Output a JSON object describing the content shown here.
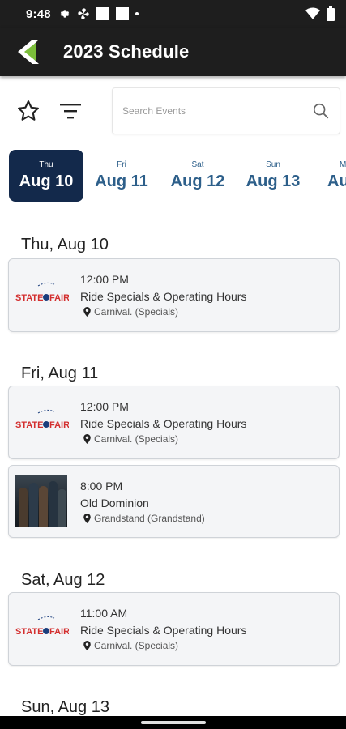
{
  "status_bar": {
    "time": "9:48",
    "icons": [
      "gear-icon",
      "fan-icon",
      "notification-square-icon",
      "notification-square-icon",
      "dot-icon",
      "wifi-icon",
      "battery-icon"
    ]
  },
  "header": {
    "title": "2023 Schedule",
    "back_icon": "back-arrow-icon",
    "accent_color": "#7bbd3a",
    "background_color": "#1e1e1e"
  },
  "toolbar": {
    "search_placeholder": "Search Events",
    "search_value": ""
  },
  "date_tabs": [
    {
      "dow": "Thu",
      "date": "Aug 10",
      "active": true
    },
    {
      "dow": "Fri",
      "date": "Aug 11",
      "active": false
    },
    {
      "dow": "Sat",
      "date": "Aug 12",
      "active": false
    },
    {
      "dow": "Sun",
      "date": "Aug 13",
      "active": false
    },
    {
      "dow": "M",
      "date": "Au",
      "active": false
    }
  ],
  "colors": {
    "active_tab": "#13294b",
    "tab_text": "#2d5f8a",
    "card_background": "#f4f5f7",
    "logo_red": "#d32f2f",
    "logo_blue": "#1a3d7c"
  },
  "sections": [
    {
      "heading": "Thu, Aug 10",
      "events": [
        {
          "thumb": "state-fair-logo",
          "logo_text_left": "STATE",
          "logo_text_right": "FAIR",
          "time": "12:00 PM",
          "title": "Ride Specials & Operating Hours",
          "location": "Carnival. (Specials)"
        }
      ]
    },
    {
      "heading": "Fri, Aug 11",
      "events": [
        {
          "thumb": "state-fair-logo",
          "logo_text_left": "STATE",
          "logo_text_right": "FAIR",
          "time": "12:00 PM",
          "title": "Ride Specials & Operating Hours",
          "location": "Carnival. (Specials)"
        },
        {
          "thumb": "band-photo",
          "time": "8:00 PM",
          "title": "Old Dominion",
          "location": "Grandstand (Grandstand)"
        }
      ]
    },
    {
      "heading": "Sat, Aug 12",
      "events": [
        {
          "thumb": "state-fair-logo",
          "logo_text_left": "STATE",
          "logo_text_right": "FAIR",
          "time": "11:00 AM",
          "title": "Ride Specials & Operating Hours",
          "location": "Carnival. (Specials)"
        }
      ]
    },
    {
      "heading": "Sun, Aug 13",
      "events": []
    }
  ]
}
